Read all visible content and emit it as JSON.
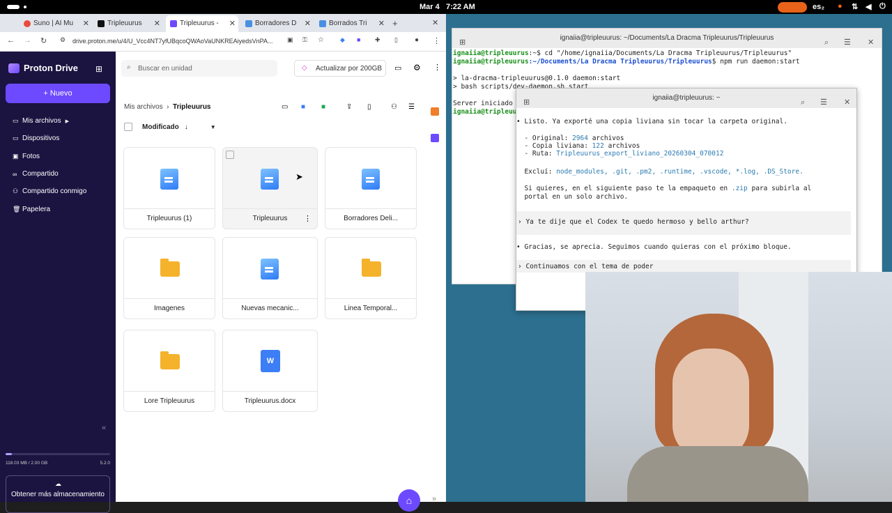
{
  "topbar": {
    "date": "Mar 4",
    "time": "7:22 AM",
    "lang": "es₂"
  },
  "tabs": [
    {
      "label": "Suno | AI Mu",
      "color": "#e94b3c"
    },
    {
      "label": "Tripleuurus",
      "color": "#111111"
    },
    {
      "label": "Tripleuurus -",
      "color": "#6d4aff"
    },
    {
      "label": "Borradores D",
      "color": "#4a90e2"
    },
    {
      "label": "Borrados Tri",
      "color": "#4a90e2"
    }
  ],
  "address": {
    "url": "drive.proton.me/u/4/U_Vcc4NT7yfUBqcoQWAoVaUNKREAiyedsVnPA..."
  },
  "sidebar": {
    "app_name": "Proton Drive",
    "new_label": "Nuevo",
    "items": [
      "Mis archivos",
      "Dispositivos",
      "Fotos",
      "Compartido",
      "Compartido conmigo",
      "Papelera"
    ],
    "storage": "118.03 MB / 2.00 GB",
    "version": "5.2.0",
    "storage_fraction": 0.06,
    "get_more": "Obtener más almacenamiento"
  },
  "main": {
    "search_placeholder": "Buscar en unidad",
    "upgrade": "Actualizar por 200GB",
    "crumb_parent": "Mis archivos",
    "crumb_current": "Tripleuurus",
    "sort_label": "Modificado",
    "items": [
      {
        "name": "Tripleuurus (1)",
        "kind": "doc"
      },
      {
        "name": "Tripleuurus",
        "kind": "doc"
      },
      {
        "name": "Borradores Deli...",
        "kind": "doc"
      },
      {
        "name": "Imagenes",
        "kind": "folder"
      },
      {
        "name": "Nuevas mecanic...",
        "kind": "doc"
      },
      {
        "name": "Linea Temporal...",
        "kind": "folder"
      },
      {
        "name": "Lore Tripleuurus",
        "kind": "folder"
      },
      {
        "name": "Tripleuurus.docx",
        "kind": "word"
      }
    ]
  },
  "term1": {
    "title": "ignaiia@tripleuurus: ~/Documents/La Dracma Tripleuurus/Tripleuurus",
    "prompt1": "ignaiia@tripleuurus",
    "cmd1": ":~$ cd \"/home/ignaiia/Documents/La Dracma Tripleuurus/Tripleuurus\"",
    "prompt2": "ignaiia@tripleuurus",
    "path2": ":~/Documents/La Dracma Tripleuurus/Tripleuurus",
    "cmd2": "$ npm run daemon:start",
    "out1": "> la-dracma-tripleuurus@0.1.0 daemon:start",
    "out2": "> bash scripts/dev-daemon.sh start",
    "out3": "Server iniciado",
    "prompt3": "ignaiia@tripleuurus"
  },
  "term2": {
    "title": "ignaiia@tripleuurus: ~",
    "l1": "• Listo. Ya exporté una copia liviana sin tocar la carpeta original.",
    "orig_label": "  - Original: ",
    "orig_val": "2964",
    "orig_rest": " archivos",
    "copy_label": "  - Copia liviana: ",
    "copy_val": "122",
    "copy_rest": " archivos",
    "path_label": "  - Ruta: ",
    "path_val": "Tripleuurus_export_liviano_20260304_070012",
    "excl_label": "  Excluí: ",
    "excl_val": "node_modules, .git, .pm2, .runtime, .vscode, *.log, .DS_Store.",
    "si1": "  Si quieres, en el siguiente paso te la empaqueto en ",
    "si_zip": ".zip",
    "si2": " para subirla al",
    "si3": "  portal en un solo archivo.",
    "q1": "› Ya te dije que el Codex te quedo hermoso y bello arthur?",
    "a1": "• Gracias, se aprecia. Seguimos cuando quieras con el próximo bloque.",
    "q2": "› Continuamos con el tema de poder"
  }
}
